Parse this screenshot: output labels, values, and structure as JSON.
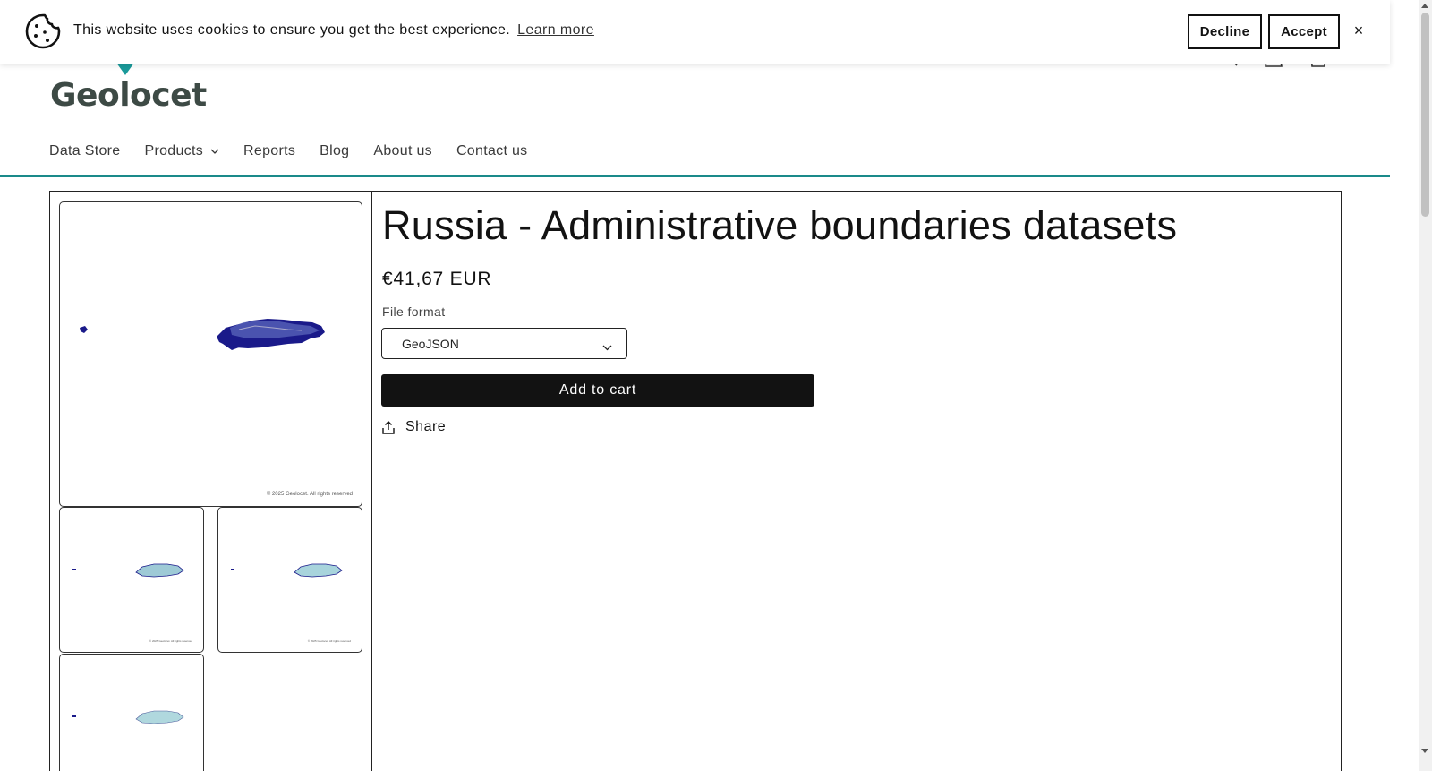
{
  "cookie_bar": {
    "message": "This website uses cookies to ensure you get the best experience.",
    "learn_more": "Learn more",
    "decline": "Decline",
    "accept": "Accept",
    "close": "×"
  },
  "header": {
    "logo": "Geolocet",
    "brand_color": "#1a9a9a",
    "nav": [
      {
        "label": "Data Store"
      },
      {
        "label": "Products"
      },
      {
        "label": "Reports"
      },
      {
        "label": "Blog"
      },
      {
        "label": "About us"
      },
      {
        "label": "Contact us"
      }
    ],
    "icons": [
      "search-icon",
      "account-icon",
      "cart-icon"
    ]
  },
  "product": {
    "title": "Russia - Administrative boundaries datasets",
    "price": "€41,67 EUR",
    "file_format_label": "File format",
    "file_format_value": "GeoJSON",
    "add_to_cart": "Add to cart",
    "share": "Share",
    "image_copyright": "© 2025 Geolocet. All rights reserved"
  }
}
